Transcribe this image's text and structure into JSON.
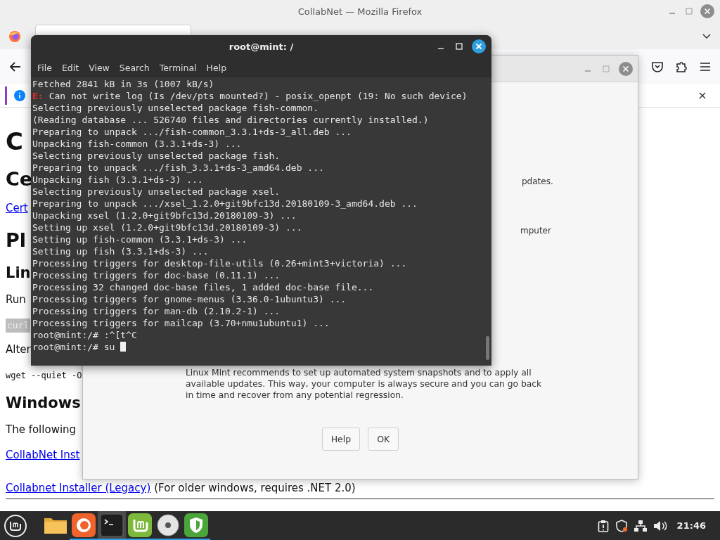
{
  "firefox": {
    "title": "CollabNet — Mozilla Firefox",
    "page": [
      {
        "kind": "h1",
        "text": "C"
      },
      {
        "kind": "h2",
        "text": "Ce"
      },
      {
        "kind": "link",
        "text": "Cert"
      },
      {
        "kind": "h2",
        "text": "Pl"
      },
      {
        "kind": "h3",
        "text": "Lin"
      },
      {
        "kind": "p",
        "text": "Run"
      },
      {
        "kind": "code",
        "text": "curl"
      },
      {
        "kind": "p",
        "text": "Alter"
      },
      {
        "kind": "pre",
        "text": "wget --quiet -O"
      },
      {
        "kind": "h3",
        "text": "Windows"
      },
      {
        "kind": "p",
        "text": "The following"
      },
      {
        "kind": "link",
        "text": "CollabNet Inst"
      },
      {
        "kind": "linkline",
        "link": "Collabnet Installer (Legacy)",
        "text": "(For older windows, requires .NET 2.0)"
      }
    ]
  },
  "update_dialog": {
    "fragments": [
      "pdates.",
      "mputer"
    ],
    "message": "Linux Mint recommends to set up automated system snapshots and to apply all available updates. This way, your computer is always secure and you can go back in time and recover from any potential regression.",
    "buttons": [
      "Help",
      "OK"
    ]
  },
  "terminal": {
    "title": "root@mint: /",
    "menu": [
      "File",
      "Edit",
      "View",
      "Search",
      "Terminal",
      "Help"
    ],
    "lines": [
      {
        "kind": "output",
        "text": "Fetched 2841 kB in 3s (1007 kB/s)"
      },
      {
        "kind": "error",
        "prefix": "E:",
        "text": "Can not write log (Is /dev/pts mounted?) - posix_openpt (19: No such device)"
      },
      {
        "kind": "output",
        "text": "Selecting previously unselected package fish-common."
      },
      {
        "kind": "output",
        "text": "(Reading database ... 526740 files and directories currently installed.)"
      },
      {
        "kind": "output",
        "text": "Preparing to unpack .../fish-common_3.3.1+ds-3_all.deb ..."
      },
      {
        "kind": "output",
        "text": "Unpacking fish-common (3.3.1+ds-3) ..."
      },
      {
        "kind": "output",
        "text": "Selecting previously unselected package fish."
      },
      {
        "kind": "output",
        "text": "Preparing to unpack .../fish_3.3.1+ds-3_amd64.deb ..."
      },
      {
        "kind": "output",
        "text": "Unpacking fish (3.3.1+ds-3) ..."
      },
      {
        "kind": "output",
        "text": "Selecting previously unselected package xsel."
      },
      {
        "kind": "output",
        "text": "Preparing to unpack .../xsel_1.2.0+git9bfc13d.20180109-3_amd64.deb ..."
      },
      {
        "kind": "output",
        "text": "Unpacking xsel (1.2.0+git9bfc13d.20180109-3) ..."
      },
      {
        "kind": "output",
        "text": "Setting up xsel (1.2.0+git9bfc13d.20180109-3) ..."
      },
      {
        "kind": "output",
        "text": "Setting up fish-common (3.3.1+ds-3) ..."
      },
      {
        "kind": "output",
        "text": "Setting up fish (3.3.1+ds-3) ..."
      },
      {
        "kind": "output",
        "text": "Processing triggers for desktop-file-utils (0.26+mint3+victoria) ..."
      },
      {
        "kind": "output",
        "text": "Processing triggers for doc-base (0.11.1) ..."
      },
      {
        "kind": "output",
        "text": "Processing 32 changed doc-base files, 1 added doc-base file..."
      },
      {
        "kind": "output",
        "text": "Processing triggers for gnome-menus (3.36.0-1ubuntu3) ..."
      },
      {
        "kind": "output",
        "text": "Processing triggers for man-db (2.10.2-1) ..."
      },
      {
        "kind": "output",
        "text": "Processing triggers for mailcap (3.70+nmu1ubuntu1) ..."
      },
      {
        "kind": "prompt",
        "text": "root@mint:/# :^[t^C",
        "cursor": false
      },
      {
        "kind": "prompt",
        "text": "root@mint:/# su",
        "cursor": true
      }
    ]
  },
  "taskbar": {
    "apps": [
      {
        "kind": "files",
        "selected": false,
        "running": false
      },
      {
        "kind": "firefox",
        "selected": false,
        "running": true
      },
      {
        "kind": "terminal",
        "selected": true,
        "running": true
      },
      {
        "kind": "mint",
        "selected": false,
        "running": true
      },
      {
        "kind": "disc",
        "selected": false,
        "running": true
      },
      {
        "kind": "shield",
        "selected": false,
        "running": true
      }
    ],
    "clock": "21:46"
  }
}
